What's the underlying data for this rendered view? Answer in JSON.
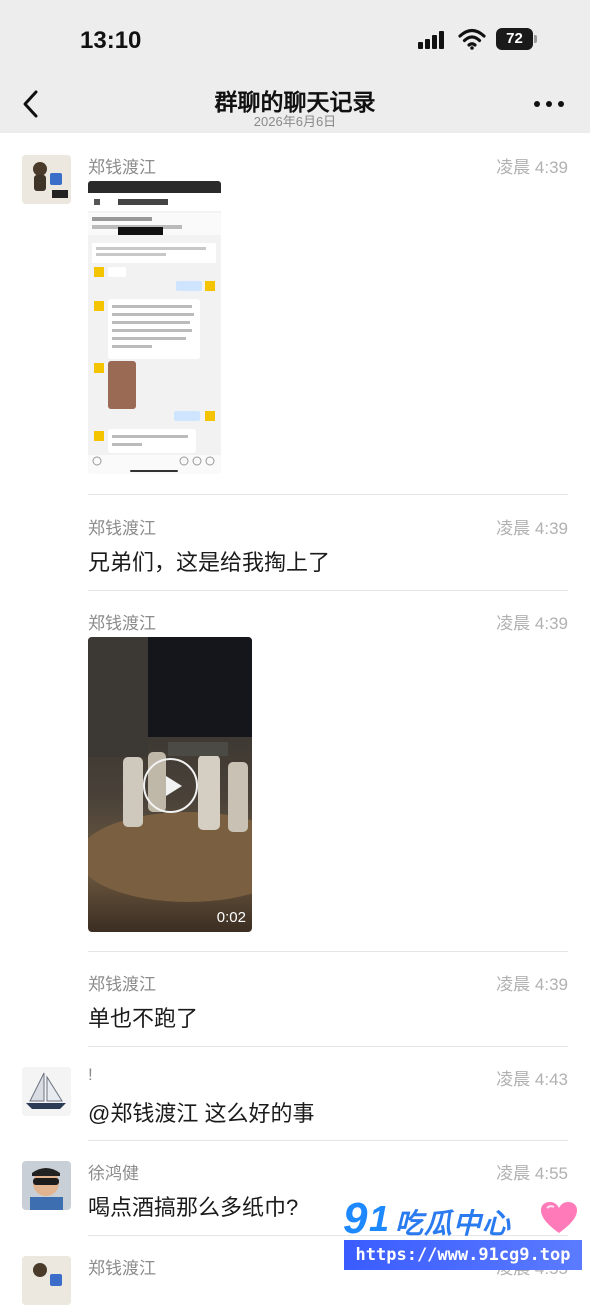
{
  "status_bar": {
    "time": "13:10",
    "battery": "72"
  },
  "header": {
    "title": "群聊的聊天记录",
    "date": "2026年6月6日"
  },
  "messages": [
    {
      "sender": "郑钱渡江",
      "time": "凌晨 4:39",
      "type": "image"
    },
    {
      "sender": "郑钱渡江",
      "time": "凌晨 4:39",
      "text": "兄弟们，这是给我掏上了"
    },
    {
      "sender": "郑钱渡江",
      "time": "凌晨 4:39",
      "type": "video",
      "duration": "0:02"
    },
    {
      "sender": "郑钱渡江",
      "time": "凌晨 4:39",
      "text": "单也不跑了"
    },
    {
      "sender": "!",
      "time": "凌晨 4:43",
      "text": "@郑钱渡江 这么好的事"
    },
    {
      "sender": "徐鸿健",
      "time": "凌晨 4:55",
      "text": "喝点酒搞那么多纸巾?"
    },
    {
      "sender": "郑钱渡江",
      "time": "凌晨 4:55"
    }
  ],
  "watermark": {
    "brand": "吃瓜中心",
    "digits_9": "9",
    "digits_1": "1",
    "url": "https://www.91cg9.top"
  },
  "colors": {
    "background": "#ffffff",
    "header_bg": "#ededed",
    "meta_gray": "#8c8c8c",
    "watermark_blue": "#1e88ff"
  },
  "icons": [
    "back-icon",
    "more-icon",
    "play-icon",
    "signal-icon",
    "wifi-icon",
    "battery-icon"
  ]
}
